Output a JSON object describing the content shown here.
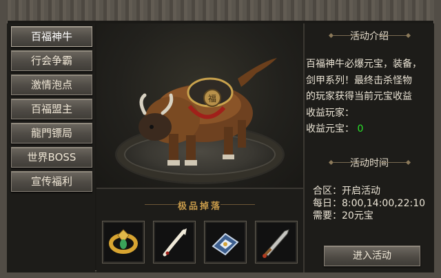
{
  "menu": {
    "items": [
      {
        "label": "百福神牛"
      },
      {
        "label": "行会争霸"
      },
      {
        "label": "激情泡点"
      },
      {
        "label": "百福盟主"
      },
      {
        "label": "龍門镖局"
      },
      {
        "label": "世界BOSS"
      },
      {
        "label": "宣传福利"
      }
    ]
  },
  "drops": {
    "title": "极品掉落",
    "items": [
      {
        "icon": "gold-jade-ring-icon"
      },
      {
        "icon": "ivory-fan-icon"
      },
      {
        "icon": "blue-bracer-icon"
      },
      {
        "icon": "broadsword-icon"
      }
    ]
  },
  "info": {
    "intro_title": "活动介绍",
    "desc_lines": [
      "百福神牛必爆元宝，装备，",
      "剑甲系列！最终击杀怪物",
      "的玩家获得当前元宝收益"
    ],
    "player_label": "收益玩家：",
    "ingot_label": "收益元宝：",
    "ingot_value": "0",
    "time_title": "活动时间",
    "schedule": [
      {
        "label": "合区：",
        "value": "开启活动"
      },
      {
        "label": "每日：",
        "value": "8:00,14:00,22:10"
      },
      {
        "label": "需要：",
        "value": "20元宝"
      }
    ],
    "enter_label": "进入活动"
  },
  "colors": {
    "income_value": "#29e229",
    "drops_title": "#c79a4a"
  }
}
